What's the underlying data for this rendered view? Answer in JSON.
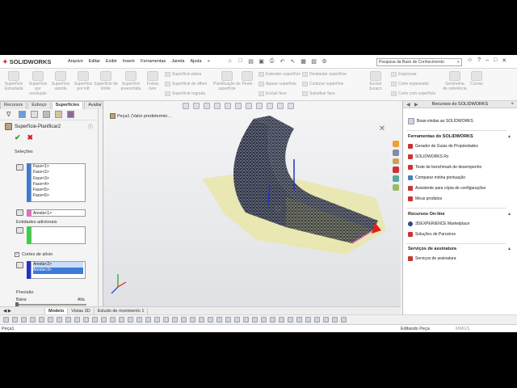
{
  "app": {
    "brand": "SOLIDWORKS",
    "brand_prefix": "3DS"
  },
  "menu": [
    "Arquivo",
    "Editar",
    "Exibir",
    "Inserir",
    "Ferramentas",
    "Janela",
    "Ajuda"
  ],
  "search": {
    "placeholder": "Pesquisa da Base de Conhecimento"
  },
  "ribbon": {
    "big_buttons": [
      "Superfície Extrudada",
      "Superfície por revolução",
      "Superfície varrida",
      "Superfície por loft",
      "Superfície de limite",
      "Superfície preenchida",
      "Forma livre",
      "Superfície plana",
      "Superfície de offset",
      "Superfície regrada",
      "Planificação de superfície",
      "Peste",
      "Estender superfície",
      "Aparar superfície",
      "Desbastar superfície",
      "Costurar superfície",
      "Excluir face",
      "Substituir face",
      "Excluir buraco",
      "Engrossar",
      "Corte espessado",
      "Corte com superfície",
      "Geometria de referência",
      "Curvas"
    ]
  },
  "tabs": [
    "Recursos",
    "Esboço",
    "Superfícies",
    "Avaliar"
  ],
  "active_tab": "Superfícies",
  "feature": {
    "title": "Superfície-Planificar2",
    "selections_label": "Seleções",
    "faces": [
      "Face<1>",
      "Face<2>",
      "Face<3>",
      "Face<4>",
      "Face<5>",
      "Face<6>"
    ],
    "edge": "Aresta<1>",
    "additional_entities_label": "Entidades adicionais",
    "relief_cuts_label": "Cortes de alívio",
    "relief_edges": [
      "Aresta<2>",
      "Aresta<3>"
    ],
    "precision_label": "Precisão",
    "precision_low": "Baixa",
    "precision_high": "Alta"
  },
  "viewport": {
    "breadcrumb": "Peça1  (Valor predetermin..."
  },
  "bottom_tabs": [
    "Modelo",
    "Vistas 3D",
    "Estudo de movimento 1"
  ],
  "active_bottom_tab": "Modelo",
  "status": {
    "left": "Peça1",
    "mode": "Editando Peça",
    "units": "MMGS"
  },
  "task_pane": {
    "title": "Recursos do SOLIDWORKS",
    "welcome": "Boas-vindas ao SOLIDWORKS",
    "sections": [
      {
        "title": "Ferramentas do SOLIDWORKS",
        "items": [
          "Gerador de Guias de Propriedades",
          "SOLIDWORKS Rx",
          "Teste de benchmark de desempenho",
          "Comparar minha pontuação",
          "Assistente para cópia de configurações",
          "Meus produtos"
        ]
      },
      {
        "title": "Recursos On-line",
        "items": [
          "3DEXPERIENCE Marketplace",
          "Soluções de Parceiros"
        ]
      },
      {
        "title": "Serviços de assinatura",
        "items": [
          "Serviços de assinatura"
        ]
      }
    ]
  },
  "colors": {
    "accent": "#d12a2a",
    "selection_blue": "#3d7bd6",
    "mesh_dark": "#2a2e3a",
    "flat_yellow": "#e9e6a8"
  }
}
